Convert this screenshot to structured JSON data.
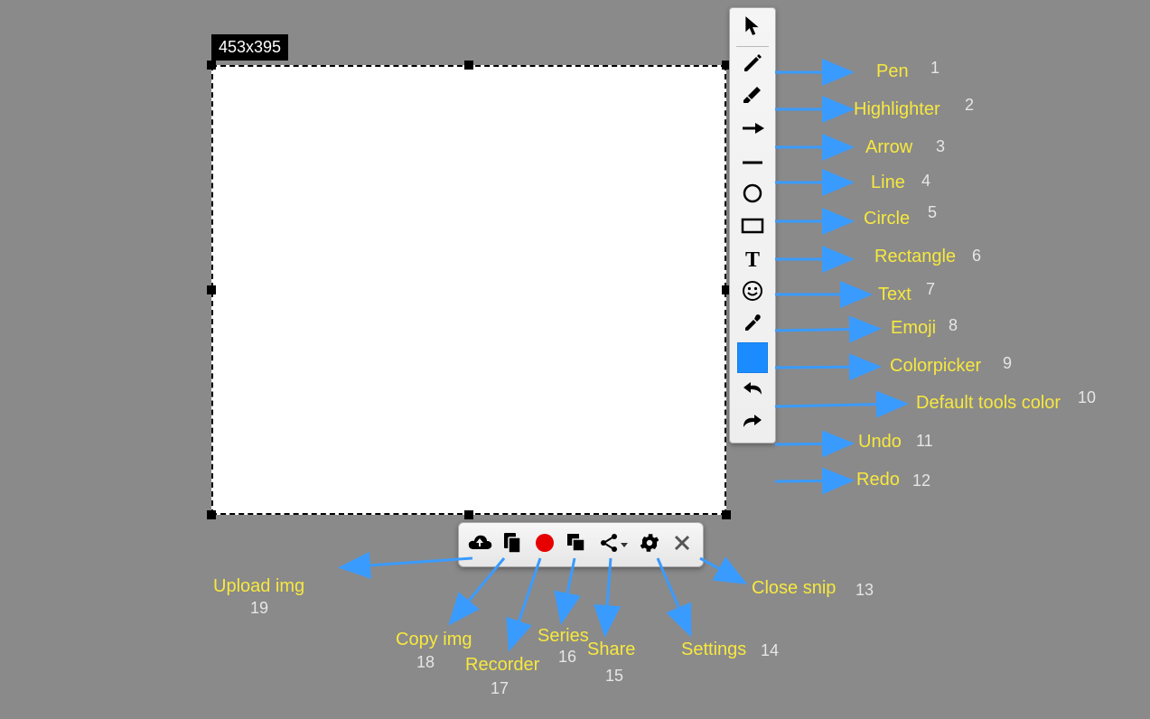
{
  "selection": {
    "dimensions_label": "453x395"
  },
  "colors": {
    "default_tool": "#1a8cff",
    "record": "#e60000",
    "label": "#f7e83f"
  },
  "vertical_toolbar": {
    "tools": [
      {
        "name": "cursor"
      },
      {
        "name": "pen"
      },
      {
        "name": "highlighter"
      },
      {
        "name": "arrow"
      },
      {
        "name": "line"
      },
      {
        "name": "circle"
      },
      {
        "name": "rectangle"
      },
      {
        "name": "text"
      },
      {
        "name": "emoji"
      },
      {
        "name": "colorpicker"
      },
      {
        "name": "default-tools-color"
      },
      {
        "name": "undo"
      },
      {
        "name": "redo"
      }
    ]
  },
  "horizontal_toolbar": {
    "buttons": [
      {
        "name": "upload-img"
      },
      {
        "name": "copy-img"
      },
      {
        "name": "recorder"
      },
      {
        "name": "series"
      },
      {
        "name": "share"
      },
      {
        "name": "settings"
      },
      {
        "name": "close-snip"
      }
    ]
  },
  "annotations": {
    "1": {
      "label": "Pen",
      "num": "1"
    },
    "2": {
      "label": "Highlighter",
      "num": "2"
    },
    "3": {
      "label": "Arrow",
      "num": "3"
    },
    "4": {
      "label": "Line",
      "num": "4"
    },
    "5": {
      "label": "Circle",
      "num": "5"
    },
    "6": {
      "label": "Rectangle",
      "num": "6"
    },
    "7": {
      "label": "Text",
      "num": "7"
    },
    "8": {
      "label": "Emoji",
      "num": "8"
    },
    "9": {
      "label": "Colorpicker",
      "num": "9"
    },
    "10": {
      "label": "Default tools color",
      "num": "10"
    },
    "11": {
      "label": "Undo",
      "num": "11"
    },
    "12": {
      "label": "Redo",
      "num": "12"
    },
    "13": {
      "label": "Close snip",
      "num": "13"
    },
    "14": {
      "label": "Settings",
      "num": "14"
    },
    "15": {
      "label": "Share",
      "num": "15"
    },
    "16": {
      "label": "Series",
      "num": "16"
    },
    "17": {
      "label": "Recorder",
      "num": "17"
    },
    "18": {
      "label": "Copy img",
      "num": "18"
    },
    "19": {
      "label": "Upload img",
      "num": "19"
    }
  }
}
